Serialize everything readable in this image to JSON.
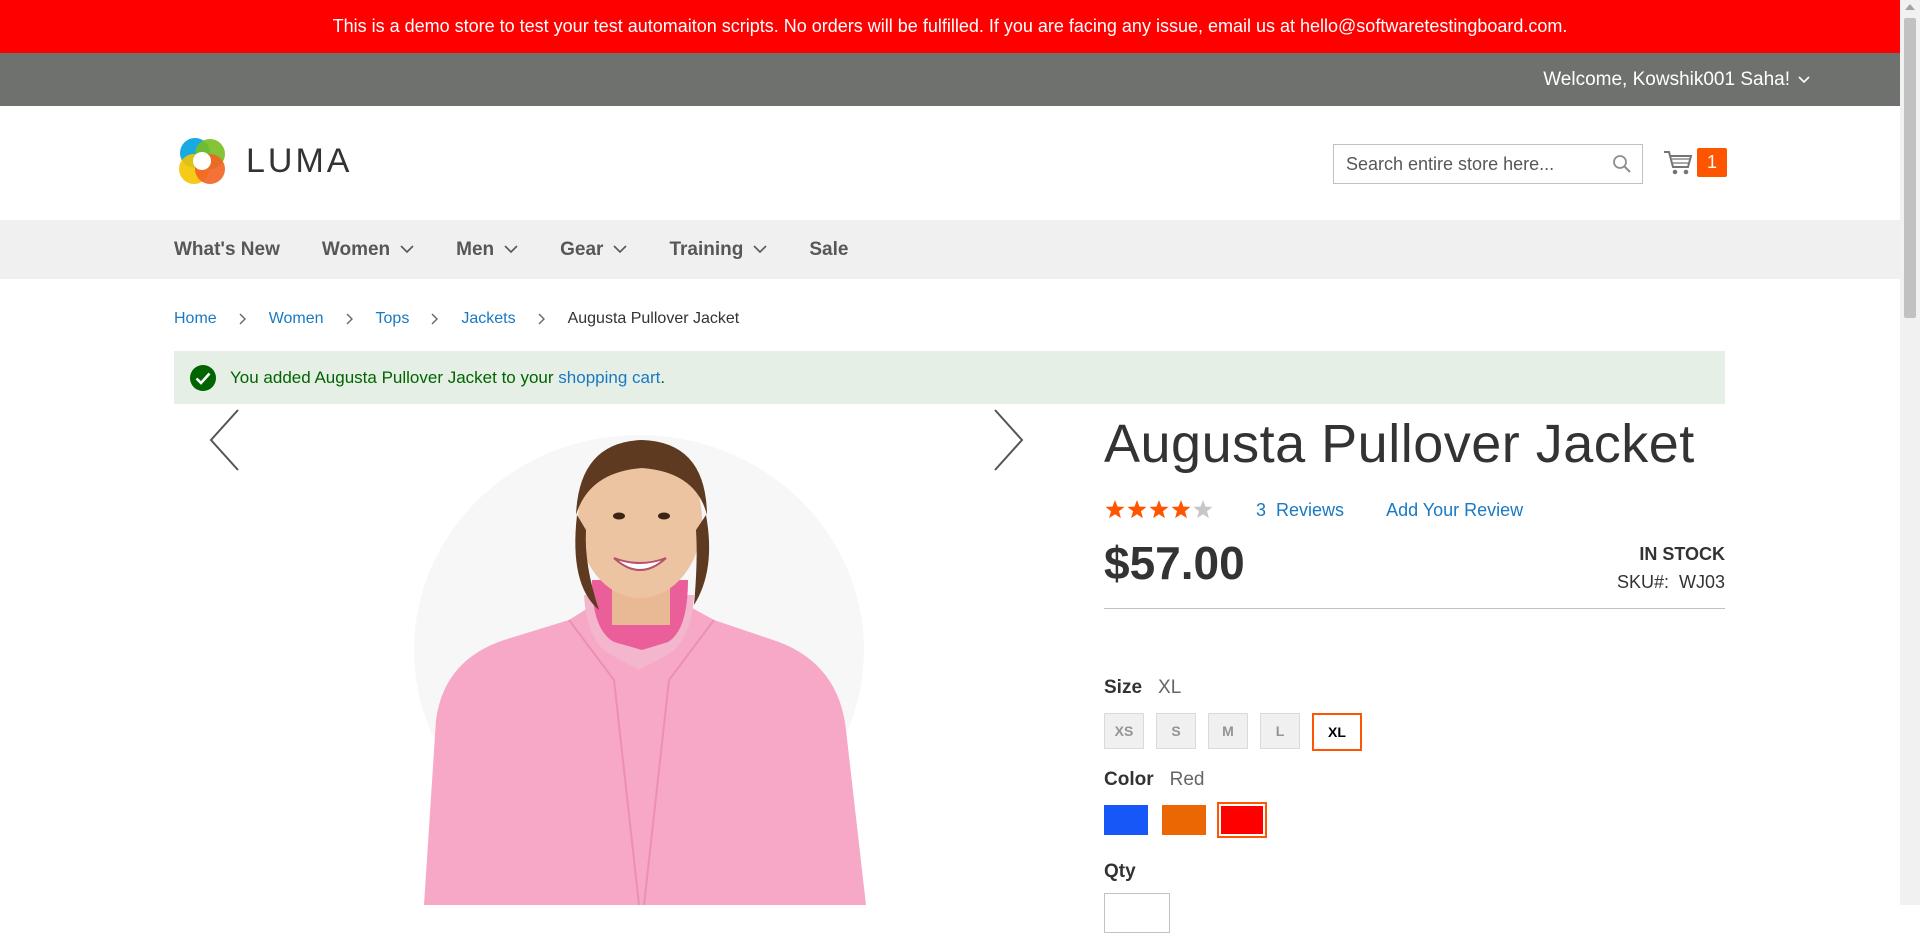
{
  "demo_notice": "This is a demo store to test your test automaiton scripts. No orders will be fulfilled. If you are facing any issue, email us at hello@softwaretestingboard.com.",
  "header_panel": {
    "welcome": "Welcome, Kowshik001 Saha!"
  },
  "logo": {
    "text": "LUMA"
  },
  "search": {
    "placeholder": "Search entire store here..."
  },
  "minicart": {
    "count": "1"
  },
  "nav": [
    {
      "label": "What's New",
      "has_dropdown": false
    },
    {
      "label": "Women",
      "has_dropdown": true
    },
    {
      "label": "Men",
      "has_dropdown": true
    },
    {
      "label": "Gear",
      "has_dropdown": true
    },
    {
      "label": "Training",
      "has_dropdown": true
    },
    {
      "label": "Sale",
      "has_dropdown": false
    }
  ],
  "breadcrumb": [
    "Home",
    "Women",
    "Tops",
    "Jackets",
    "Augusta Pullover Jacket"
  ],
  "message": {
    "prefix": "You added Augusta Pullover Jacket to your",
    "link": "shopping cart",
    "suffix": "."
  },
  "product": {
    "title": "Augusta Pullover Jacket",
    "rating_stars": 4,
    "rating_max": 5,
    "reviews_count": "3",
    "reviews_label": "Reviews",
    "add_review": "Add Your Review",
    "price": "$57.00",
    "stock": "IN STOCK",
    "sku_label": "SKU#:",
    "sku": "WJ03",
    "size_label": "Size",
    "size_selected": "XL",
    "sizes": [
      "XS",
      "S",
      "M",
      "L",
      "XL"
    ],
    "color_label": "Color",
    "color_selected": "Red",
    "colors": [
      {
        "name": "Blue",
        "hex": "#1857f7"
      },
      {
        "name": "Orange",
        "hex": "#eb6703"
      },
      {
        "name": "Red",
        "hex": "#ff0000"
      }
    ],
    "qty_label": "Qty"
  },
  "colors": {
    "accent": "#ff5501",
    "link": "#1979c3",
    "demo_bar": "#ff0000",
    "panel_bar": "#6e716e"
  }
}
